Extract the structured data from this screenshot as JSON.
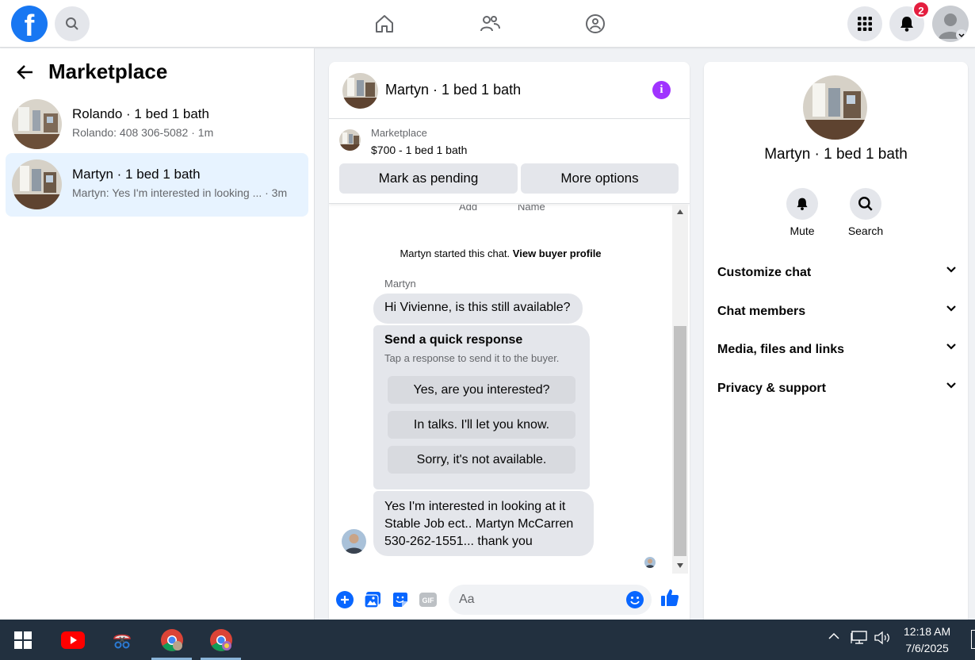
{
  "topbar": {
    "logo": "f",
    "notification_count": "2",
    "icons": [
      "search-icon",
      "home-icon",
      "friends-icon",
      "groups-icon",
      "apps-grid-icon",
      "bell-icon",
      "profile-avatar"
    ]
  },
  "marketplace": {
    "title": "Marketplace",
    "conversations": [
      {
        "title": "Rolando · 1 bed 1 bath",
        "preview": "Rolando: 408 306-5082 · 1m",
        "active": false
      },
      {
        "title": "Martyn · 1 bed 1 bath",
        "preview": "Martyn: Yes I'm interested in looking ... · 3m",
        "active": true
      }
    ]
  },
  "chat": {
    "title": "Martyn · 1 bed 1 bath",
    "listing": {
      "source": "Marketplace",
      "price_line": "$700 - 1 bed 1 bath",
      "mark_pending_label": "Mark as pending",
      "more_options_label": "More options"
    },
    "cut_off_labels": [
      "Add",
      "Name"
    ],
    "started_text": "Martyn started this chat.",
    "view_profile_label": "View buyer profile",
    "sender_name": "Martyn",
    "first_message": "Hi Vivienne, is this still available?",
    "quick_response": {
      "title": "Send a quick response",
      "subtitle": "Tap a response to send it to the buyer.",
      "options": [
        "Yes, are you interested?",
        "In talks. I'll let you know.",
        "Sorry, it's not available."
      ]
    },
    "last_message_lines": [
      "Yes I'm interested in looking at it",
      "Stable Job ect.. Martyn McCarren",
      "530-262-1551... thank you"
    ],
    "composer_placeholder": "Aa"
  },
  "details": {
    "title": "Martyn · 1 bed 1 bath",
    "actions": [
      {
        "label": "Mute",
        "icon": "bell-icon"
      },
      {
        "label": "Search",
        "icon": "search-icon"
      }
    ],
    "sections": [
      "Customize chat",
      "Chat members",
      "Media, files and links",
      "Privacy & support"
    ]
  },
  "taskbar": {
    "time": "12:18 AM",
    "date": "7/6/2025"
  },
  "colors": {
    "brand_blue": "#1877f2",
    "active_conv_bg": "#e7f3ff",
    "info_purple": "#a033ff",
    "badge_red": "#e41e3f",
    "taskbar_bg": "#22303f"
  }
}
